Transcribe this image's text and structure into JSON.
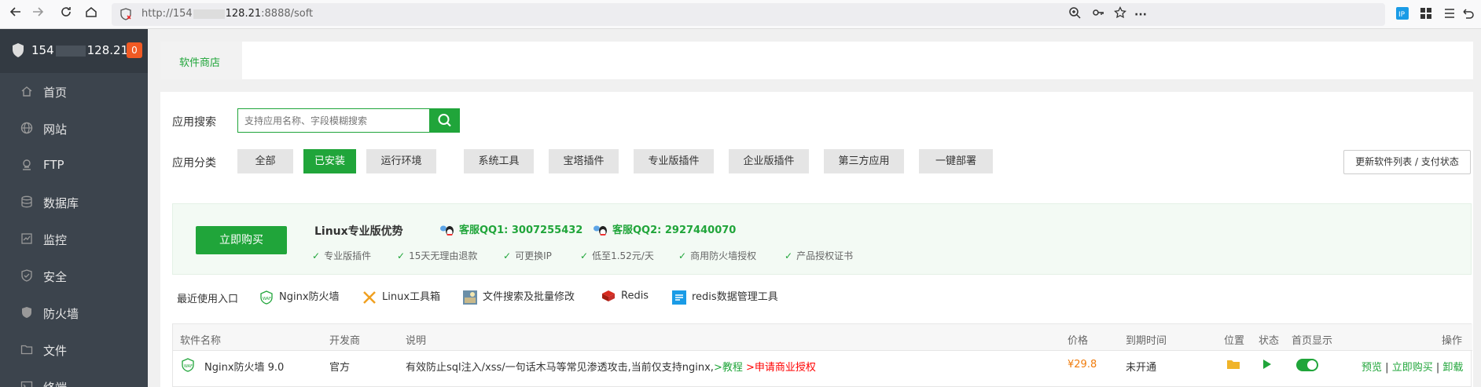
{
  "browser": {
    "url_prefix": "http://154",
    "url_host_end": "128.21",
    "url_suffix": ":8888/soft"
  },
  "sidebar": {
    "ip_start": "154",
    "ip_end": "128.21",
    "badge": "0",
    "items": [
      {
        "label": "首页",
        "icon": "home-icon"
      },
      {
        "label": "网站",
        "icon": "globe-icon"
      },
      {
        "label": "FTP",
        "icon": "ftp-icon"
      },
      {
        "label": "数据库",
        "icon": "database-icon"
      },
      {
        "label": "监控",
        "icon": "monitor-icon"
      },
      {
        "label": "安全",
        "icon": "shield-icon"
      },
      {
        "label": "防火墙",
        "icon": "firewall-icon"
      },
      {
        "label": "文件",
        "icon": "folder-icon"
      },
      {
        "label": "终端",
        "icon": "terminal-icon"
      }
    ]
  },
  "tabs": {
    "active": "软件商店"
  },
  "search": {
    "label": "应用搜索",
    "placeholder": "支持应用名称、字段模糊搜索"
  },
  "categories": {
    "label": "应用分类",
    "items": [
      "全部",
      "已安装",
      "运行环境",
      "系统工具",
      "宝塔插件",
      "专业版插件",
      "企业版插件",
      "第三方应用",
      "一键部署"
    ],
    "active_index": 1,
    "refresh_label": "更新软件列表 / 支付状态"
  },
  "promo": {
    "buy_label": "立即购买",
    "title": "Linux专业版优势",
    "qq1": "客服QQ1: 3007255432",
    "qq2": "客服QQ2: 2927440070",
    "features": [
      "专业版插件",
      "15天无理由退款",
      "可更换IP",
      "低至1.52元/天",
      "商用防火墙授权",
      "产品授权证书"
    ]
  },
  "recent": {
    "label": "最近使用入口",
    "items": [
      "Nginx防火墙",
      "Linux工具箱",
      "文件搜索及批量修改",
      "Redis",
      "redis数据管理工具"
    ]
  },
  "table": {
    "headers": [
      "软件名称",
      "开发商",
      "说明",
      "价格",
      "到期时间",
      "位置",
      "状态",
      "首页显示",
      "操作"
    ],
    "rows": [
      {
        "name": "Nginx防火墙 9.0",
        "developer": "官方",
        "desc": "有效防止sql注入/xss/一句话木马等常见渗透攻击,当前仅支持nginx,",
        "tutorial": ">教程",
        "apply": ">申请商业授权",
        "price": "¥29.8",
        "expiry": "未开通",
        "ops_preview": "预览",
        "ops_sep1": "|",
        "ops_buy": "立即购买",
        "ops_sep2": "|",
        "ops_uninstall": "卸载",
        "home_display": true
      }
    ]
  }
}
